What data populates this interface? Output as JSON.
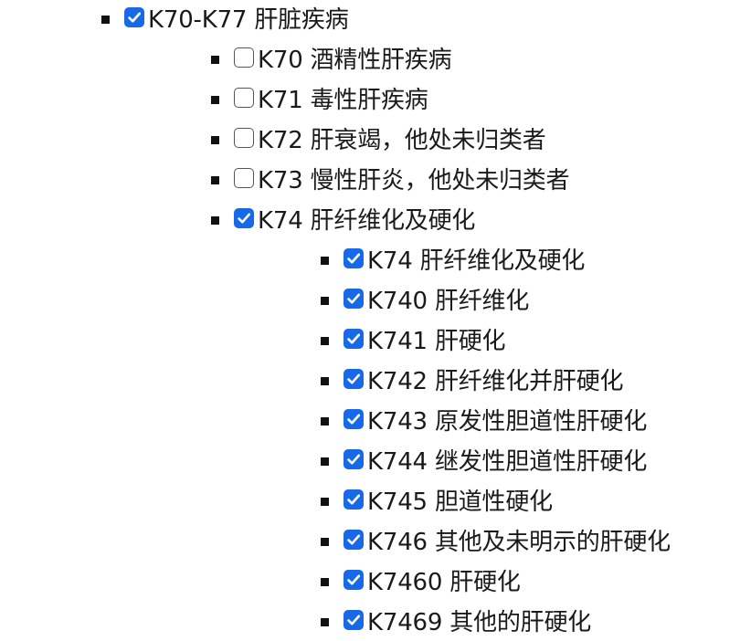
{
  "tree": {
    "parent": {
      "label": "K70-K77 肝脏疾病",
      "checked": true
    },
    "children": [
      {
        "label": "K70 酒精性肝疾病",
        "checked": false
      },
      {
        "label": "K71 毒性肝疾病",
        "checked": false
      },
      {
        "label": "K72 肝衰竭，他处未归类者",
        "checked": false
      },
      {
        "label": "K73 慢性肝炎，他处未归类者",
        "checked": false
      },
      {
        "label": "K74 肝纤维化及硬化",
        "checked": true
      }
    ],
    "grandchildren": [
      {
        "label": "K74 肝纤维化及硬化",
        "checked": true
      },
      {
        "label": "K740 肝纤维化",
        "checked": true
      },
      {
        "label": "K741 肝硬化",
        "checked": true
      },
      {
        "label": "K742 肝纤维化并肝硬化",
        "checked": true
      },
      {
        "label": "K743 原发性胆道性肝硬化",
        "checked": true
      },
      {
        "label": "K744 继发性胆道性肝硬化",
        "checked": true
      },
      {
        "label": "K745 胆道性硬化",
        "checked": true
      },
      {
        "label": "K746 其他及未明示的肝硬化",
        "checked": true
      },
      {
        "label": "K7460 肝硬化",
        "checked": true
      },
      {
        "label": "K7469 其他的肝硬化",
        "checked": true
      }
    ]
  },
  "colors": {
    "checkbox_checked": "#1769e8",
    "checkbox_border": "#555555",
    "bullet": "#111111",
    "text": "#1a1a1a"
  },
  "icons": {
    "bullet": "square-bullet-icon",
    "checked": "checkmark-icon"
  }
}
